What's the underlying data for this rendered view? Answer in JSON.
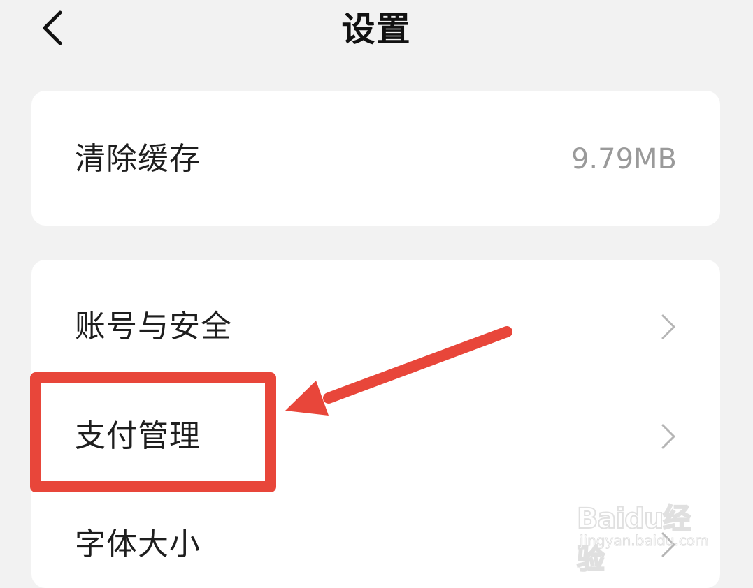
{
  "header": {
    "title": "设置",
    "back_icon": "chevron-left-icon"
  },
  "cache_card": {
    "label": "清除缓存",
    "value": "9.79MB"
  },
  "settings_card": {
    "items": [
      {
        "label": "账号与安全",
        "icon": "chevron-right-icon"
      },
      {
        "label": "支付管理",
        "icon": "chevron-right-icon"
      },
      {
        "label": "字体大小",
        "icon": "chevron-right-icon"
      }
    ]
  },
  "annotation": {
    "highlight_color": "#e8463a",
    "highlighted_item": "支付管理"
  },
  "watermark": {
    "brand": "Baidu经验",
    "url": "jingyan.baidu.com"
  },
  "colors": {
    "background": "#f2f2f2",
    "card": "#ffffff",
    "text": "#1e1e1e",
    "secondary_text": "#9a9a9a",
    "chevron": "#b5b5b5",
    "annotation_red": "#e8463a"
  }
}
